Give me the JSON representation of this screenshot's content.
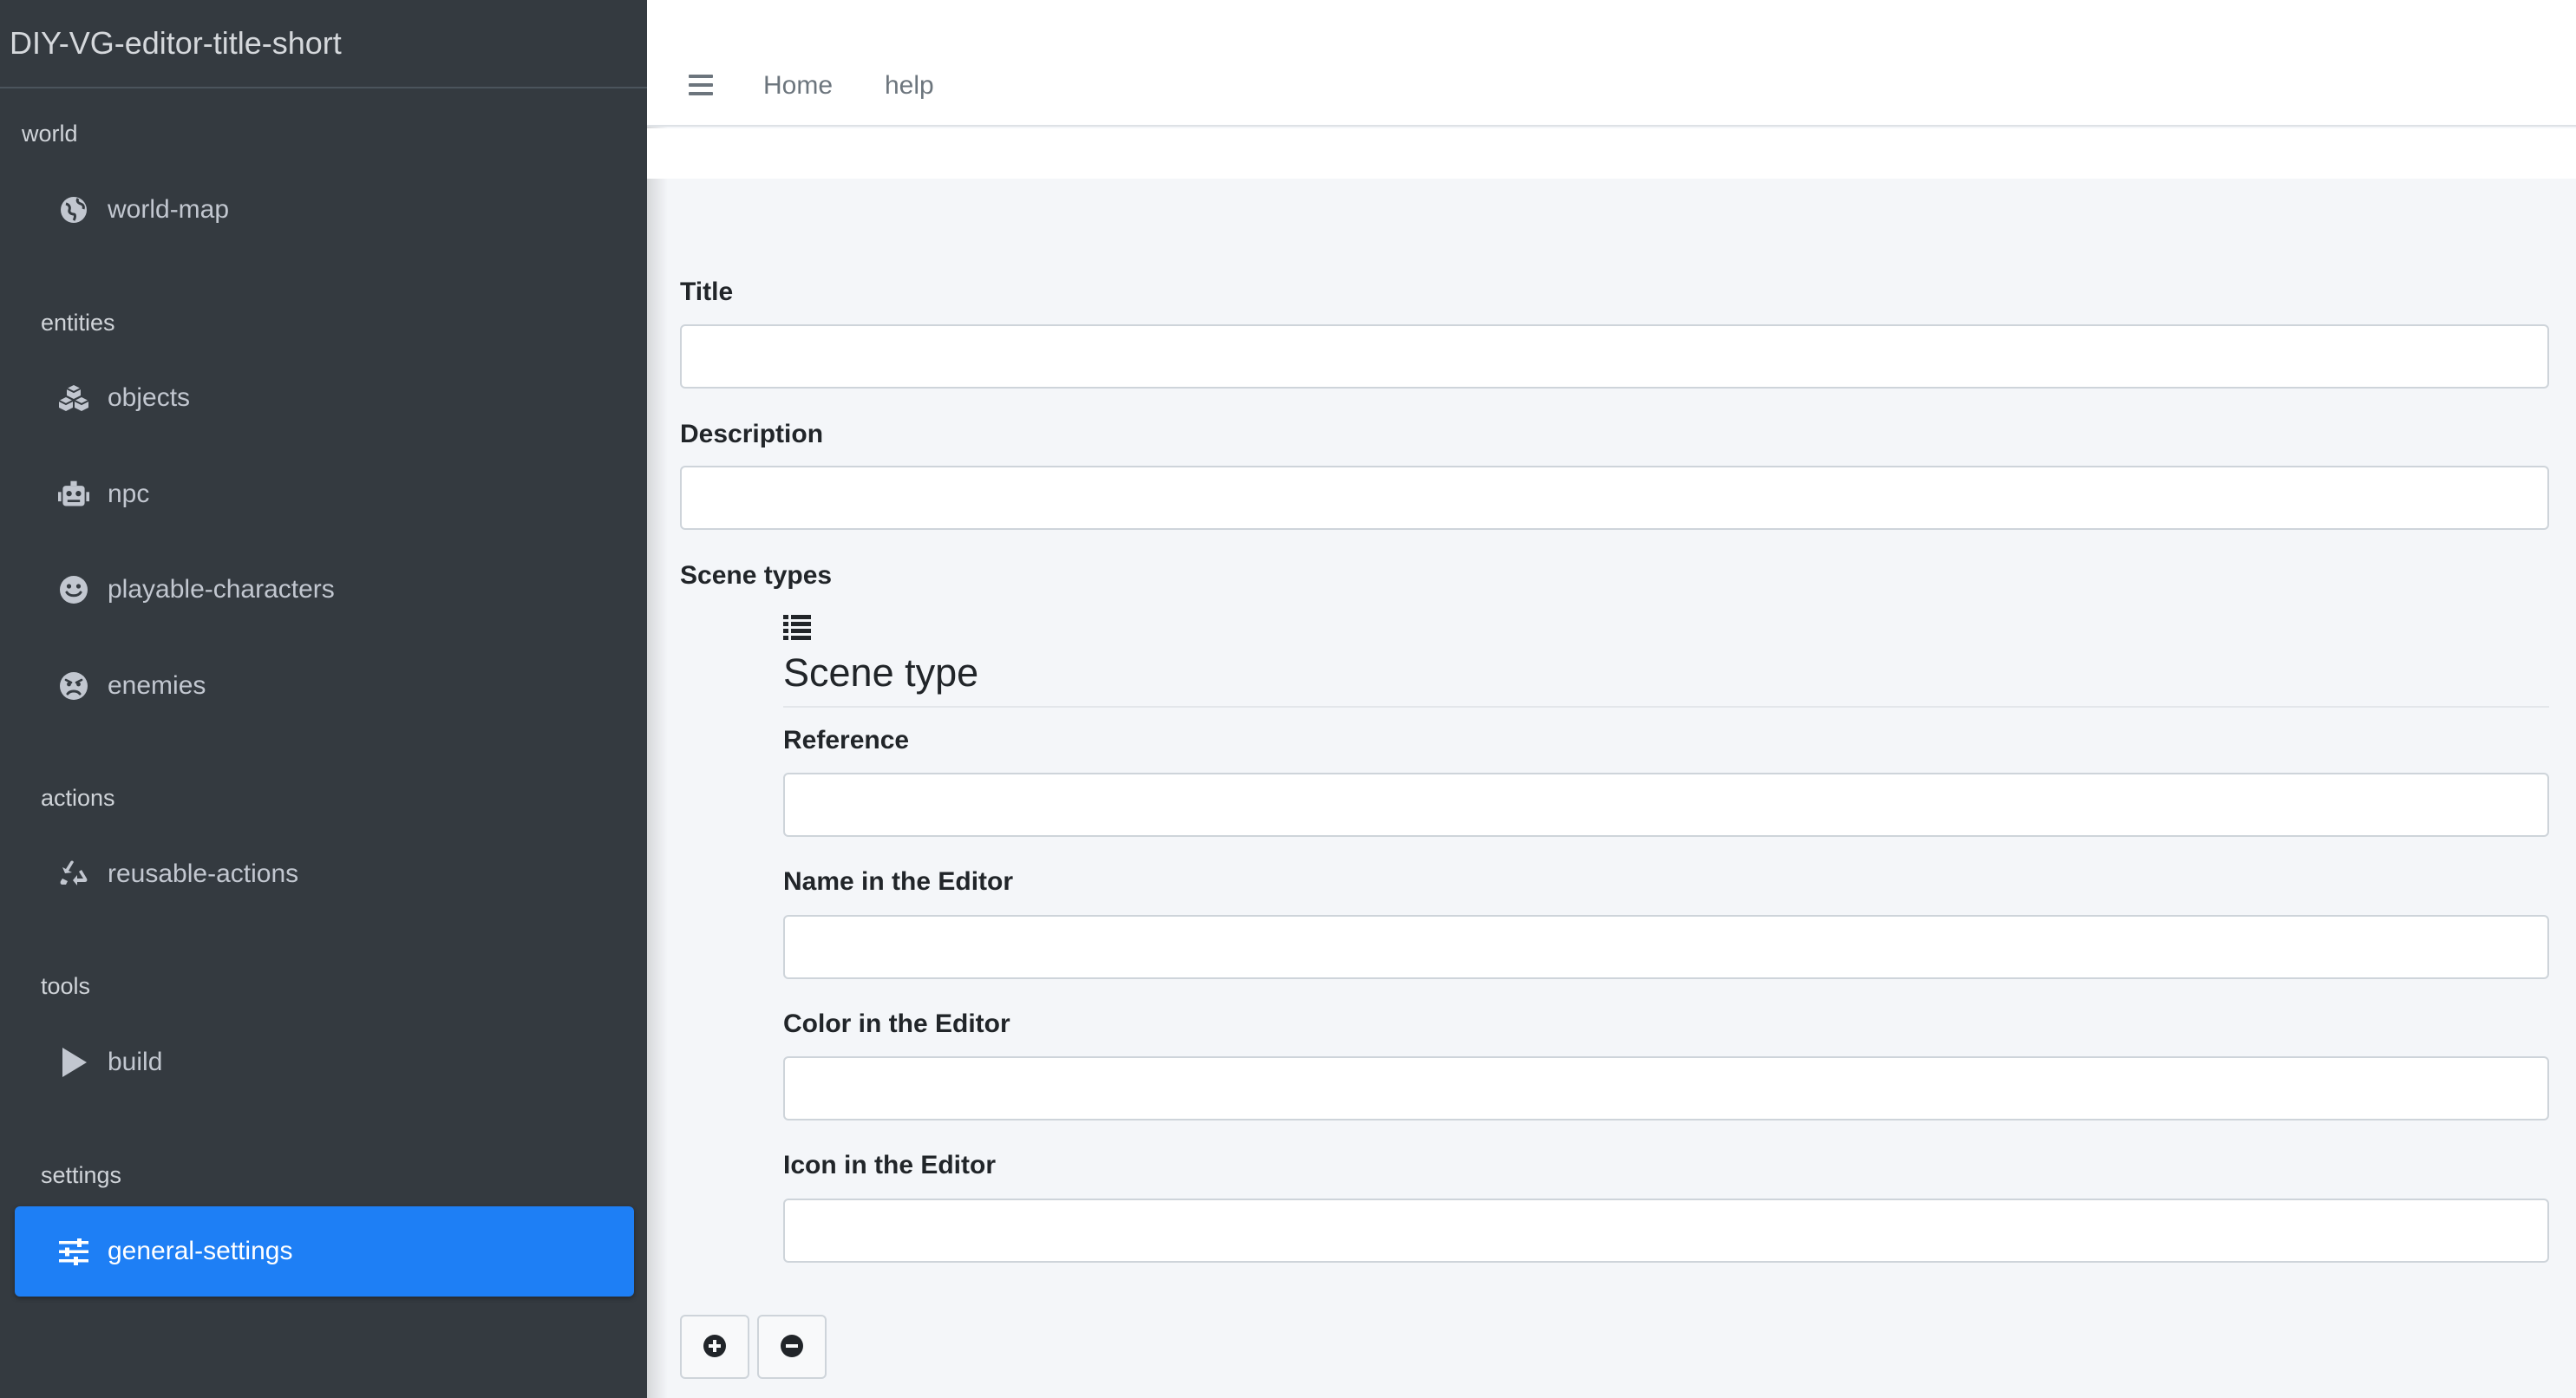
{
  "sidebar": {
    "brand": "DIY-VG-editor-title-short",
    "sections": {
      "world": {
        "header": "world",
        "items": [
          {
            "label": "world-map",
            "icon": "globe-icon"
          }
        ]
      },
      "entities": {
        "header": "entities",
        "items": [
          {
            "label": "objects",
            "icon": "cubes-icon"
          },
          {
            "label": "npc",
            "icon": "robot-icon"
          },
          {
            "label": "playable-characters",
            "icon": "smile-icon"
          },
          {
            "label": "enemies",
            "icon": "angry-face-icon"
          }
        ]
      },
      "actions": {
        "header": "actions",
        "items": [
          {
            "label": "reusable-actions",
            "icon": "recycle-icon"
          }
        ]
      },
      "tools": {
        "header": "tools",
        "items": [
          {
            "label": "build",
            "icon": "play-icon"
          }
        ]
      },
      "settings": {
        "header": "settings",
        "items": [
          {
            "label": "general-settings",
            "icon": "sliders-icon",
            "active": true
          }
        ]
      }
    },
    "active_color": "#1e7ff5",
    "background_color": "#343a40"
  },
  "topbar": {
    "menu_icon": "hamburger-icon",
    "links": [
      "Home",
      "help"
    ]
  },
  "form": {
    "title_label": "Title",
    "title_value": "",
    "description_label": "Description",
    "description_value": "",
    "scene_types_label": "Scene types",
    "scene_type": {
      "list_icon": "list-icon",
      "heading": "Scene type",
      "reference_label": "Reference",
      "reference_value": "",
      "name_label": "Name in the Editor",
      "name_value": "",
      "color_label": "Color in the Editor",
      "color_value": "",
      "icon_label": "Icon in the Editor",
      "icon_value": ""
    },
    "add_icon": "plus-circle-icon",
    "remove_icon": "minus-circle-icon"
  }
}
